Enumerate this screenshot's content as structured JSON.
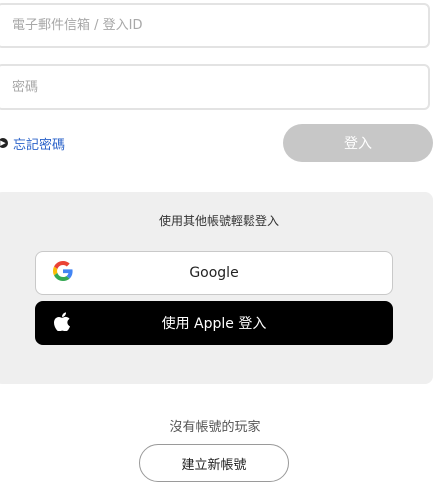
{
  "login": {
    "email_placeholder": "電子郵件信箱 / 登入ID",
    "email_value": "",
    "password_placeholder": "密碼",
    "password_value": "",
    "forgot_label": "忘記密碼",
    "login_label": "登入",
    "login_enabled": false
  },
  "social": {
    "title": "使用其他帳號輕鬆登入",
    "google_label": "Google",
    "apple_label": "使用 Apple 登入"
  },
  "signup": {
    "prompt": "沒有帳號的玩家",
    "create_label": "建立新帳號"
  },
  "colors": {
    "link": "#2a62c9",
    "disabled_button": "#c7c7c7",
    "panel": "#efefef"
  }
}
